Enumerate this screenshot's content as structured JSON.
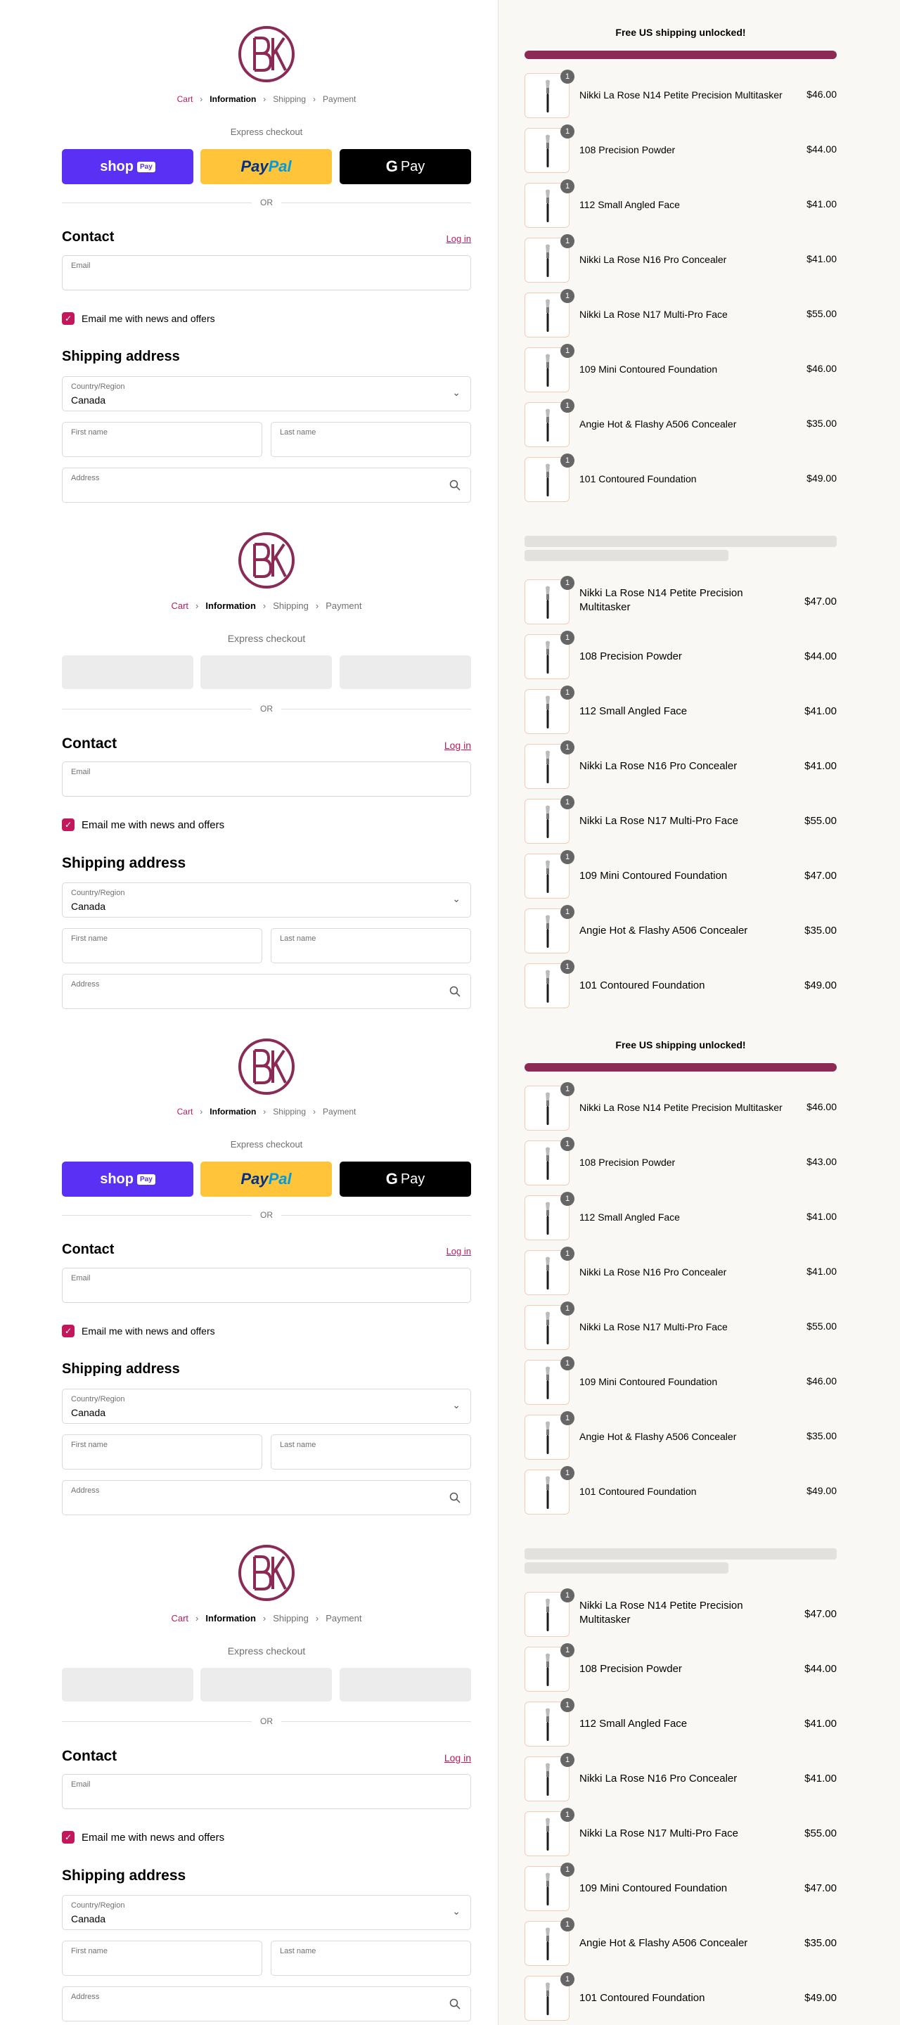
{
  "brand": {
    "logo_letters": "BK",
    "accent": "#8b2a55",
    "link": "#c2185b"
  },
  "breadcrumb": [
    "Cart",
    "Information",
    "Shipping",
    "Payment"
  ],
  "express": {
    "title": "Express checkout",
    "shop_label": "shop",
    "shop_pay": "Pay",
    "paypal_a": "Pay",
    "paypal_b": "Pal",
    "gpay_g": "G",
    "gpay_label": "Pay"
  },
  "or_label": "OR",
  "contact": {
    "heading": "Contact",
    "login": "Log in",
    "email_label": "Email",
    "newsletter": "Email me with news and offers"
  },
  "shipping": {
    "heading": "Shipping address",
    "country_label": "Country/Region",
    "country_value": "Canada",
    "first_label": "First name",
    "last_label": "Last name",
    "address_label": "Address"
  },
  "summary": {
    "shipping_msg": "Free US shipping unlocked!"
  },
  "sections": [
    {
      "variant": "a",
      "items": [
        {
          "name": "Nikki La Rose N14 Petite Precision Multitasker",
          "price": "$46.00",
          "qty": "1"
        },
        {
          "name": "108 Precision Powder",
          "price": "$44.00",
          "qty": "1"
        },
        {
          "name": "112 Small Angled Face",
          "price": "$41.00",
          "qty": "1"
        },
        {
          "name": "Nikki La Rose N16 Pro Concealer",
          "price": "$41.00",
          "qty": "1"
        },
        {
          "name": "Nikki La Rose N17 Multi-Pro Face",
          "price": "$55.00",
          "qty": "1"
        },
        {
          "name": "109 Mini Contoured Foundation",
          "price": "$46.00",
          "qty": "1"
        },
        {
          "name": "Angie Hot & Flashy A506 Concealer",
          "price": "$35.00",
          "qty": "1"
        },
        {
          "name": "101 Contoured Foundation",
          "price": "$49.00",
          "qty": "1"
        }
      ]
    },
    {
      "variant": "b",
      "items": [
        {
          "name": "Nikki La Rose N14 Petite Precision Multitasker",
          "price": "$47.00",
          "qty": "1"
        },
        {
          "name": "108 Precision Powder",
          "price": "$44.00",
          "qty": "1"
        },
        {
          "name": "112 Small Angled Face",
          "price": "$41.00",
          "qty": "1"
        },
        {
          "name": "Nikki La Rose N16 Pro Concealer",
          "price": "$41.00",
          "qty": "1"
        },
        {
          "name": "Nikki La Rose N17 Multi-Pro Face",
          "price": "$55.00",
          "qty": "1"
        },
        {
          "name": "109 Mini Contoured Foundation",
          "price": "$47.00",
          "qty": "1"
        },
        {
          "name": "Angie Hot & Flashy A506 Concealer",
          "price": "$35.00",
          "qty": "1"
        },
        {
          "name": "101 Contoured Foundation",
          "price": "$49.00",
          "qty": "1"
        }
      ]
    },
    {
      "variant": "a",
      "items": [
        {
          "name": "Nikki La Rose N14 Petite Precision Multitasker",
          "price": "$46.00",
          "qty": "1"
        },
        {
          "name": "108 Precision Powder",
          "price": "$43.00",
          "qty": "1"
        },
        {
          "name": "112 Small Angled Face",
          "price": "$41.00",
          "qty": "1"
        },
        {
          "name": "Nikki La Rose N16 Pro Concealer",
          "price": "$41.00",
          "qty": "1"
        },
        {
          "name": "Nikki La Rose N17 Multi-Pro Face",
          "price": "$55.00",
          "qty": "1"
        },
        {
          "name": "109 Mini Contoured Foundation",
          "price": "$46.00",
          "qty": "1"
        },
        {
          "name": "Angie Hot & Flashy A506 Concealer",
          "price": "$35.00",
          "qty": "1"
        },
        {
          "name": "101 Contoured Foundation",
          "price": "$49.00",
          "qty": "1"
        }
      ]
    },
    {
      "variant": "b",
      "items": [
        {
          "name": "Nikki La Rose N14 Petite Precision Multitasker",
          "price": "$47.00",
          "qty": "1"
        },
        {
          "name": "108 Precision Powder",
          "price": "$44.00",
          "qty": "1"
        },
        {
          "name": "112 Small Angled Face",
          "price": "$41.00",
          "qty": "1"
        },
        {
          "name": "Nikki La Rose N16 Pro Concealer",
          "price": "$41.00",
          "qty": "1"
        },
        {
          "name": "Nikki La Rose N17 Multi-Pro Face",
          "price": "$55.00",
          "qty": "1"
        },
        {
          "name": "109 Mini Contoured Foundation",
          "price": "$47.00",
          "qty": "1"
        },
        {
          "name": "Angie Hot & Flashy A506 Concealer",
          "price": "$35.00",
          "qty": "1"
        },
        {
          "name": "101 Contoured Foundation",
          "price": "$49.00",
          "qty": "1"
        }
      ]
    }
  ]
}
